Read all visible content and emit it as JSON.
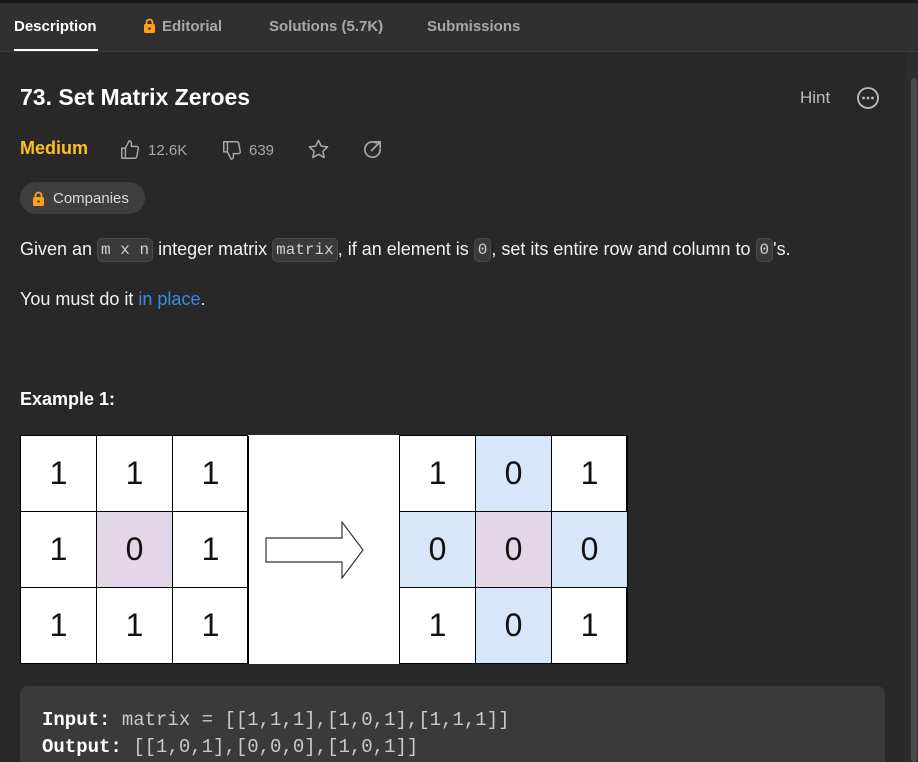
{
  "tabs": [
    {
      "label": "Description",
      "active": true
    },
    {
      "label": "Editorial",
      "locked": true,
      "icon": "lock-icon"
    },
    {
      "label": "Solutions (5.7K)"
    },
    {
      "label": "Submissions"
    }
  ],
  "problem": {
    "title": "73. Set Matrix Zeroes",
    "hint_label": "Hint",
    "difficulty": "Medium",
    "likes": "12.6K",
    "dislikes": "639",
    "companies_label": "Companies"
  },
  "description": {
    "p1_a": "Given an ",
    "p1_code1": "m x n",
    "p1_b": " integer matrix ",
    "p1_code2": "matrix",
    "p1_c": ", if an element is ",
    "p1_code3": "0",
    "p1_d": ", set its entire row and column to ",
    "p1_code4": "0",
    "p1_e": "'s.",
    "p2_a": "You must do it ",
    "p2_link": "in place",
    "p2_b": "."
  },
  "example": {
    "title": "Example 1:",
    "input_matrix": [
      [
        "1",
        "1",
        "1"
      ],
      [
        "1",
        "0",
        "1"
      ],
      [
        "1",
        "1",
        "1"
      ]
    ],
    "output_matrix": [
      [
        "1",
        "0",
        "1"
      ],
      [
        "0",
        "0",
        "0"
      ],
      [
        "1",
        "0",
        "1"
      ]
    ],
    "input_label": "Input:",
    "input_value": "matrix = [[1,1,1],[1,0,1],[1,1,1]]",
    "output_label": "Output:",
    "output_value": "[[1,0,1],[0,0,0],[1,0,1]]"
  },
  "colors": {
    "difficulty_medium": "#ffc01e",
    "link": "#3c8ae6",
    "zero_cell": "#e2d6e8",
    "zeroed_cell": "#d7e6f8"
  }
}
